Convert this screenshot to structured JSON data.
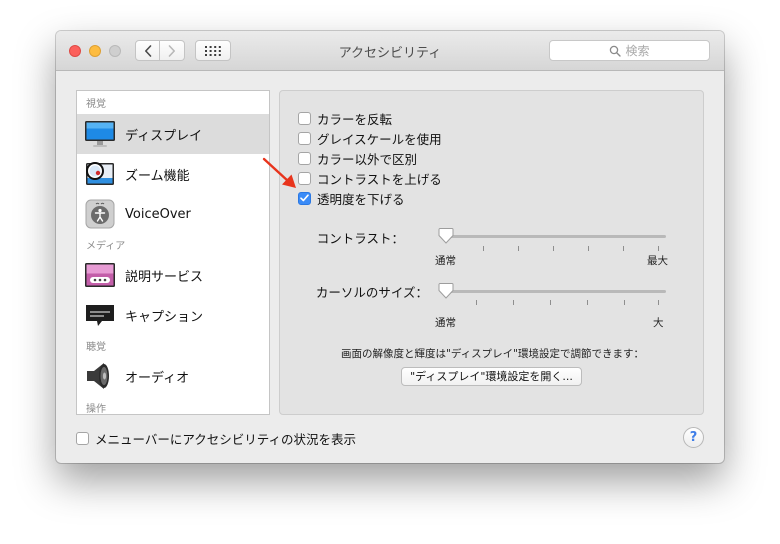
{
  "window": {
    "title": "アクセシビリティ"
  },
  "toolbar": {
    "search_placeholder": "検索"
  },
  "sidebar": {
    "sections": {
      "vision": "視覚",
      "media": "メディア",
      "hearing": "聴覚",
      "interaction": "操作"
    },
    "items": [
      {
        "label": "ディスプレイ",
        "icon": "display-icon",
        "selected": true
      },
      {
        "label": "ズーム機能",
        "icon": "zoom-icon",
        "selected": false
      },
      {
        "label": "VoiceOver",
        "icon": "voiceover-icon",
        "selected": false
      },
      {
        "label": "説明サービス",
        "icon": "descriptions-icon",
        "selected": false
      },
      {
        "label": "キャプション",
        "icon": "captions-icon",
        "selected": false
      },
      {
        "label": "オーディオ",
        "icon": "speaker-icon",
        "selected": false
      }
    ]
  },
  "display": {
    "options": [
      {
        "label": "カラーを反転",
        "checked": false
      },
      {
        "label": "グレイスケールを使用",
        "checked": false
      },
      {
        "label": "カラー以外で区別",
        "checked": false
      },
      {
        "label": "コントラストを上げる",
        "checked": false
      },
      {
        "label": "透明度を下げる",
        "checked": true
      }
    ],
    "contrast": {
      "label": "コントラスト：",
      "min_label": "通常",
      "max_label": "最大",
      "value": 0
    },
    "cursor": {
      "label": "カーソルのサイズ：",
      "min_label": "通常",
      "max_label": "大",
      "value": 0
    },
    "note": "画面の解像度と輝度は\"ディスプレイ\"環境設定で調節できます：",
    "open_button": "\"ディスプレイ\"環境設定を開く..."
  },
  "footer": {
    "menubar_label": "メニューバーにアクセシビリティの状況を表示",
    "menubar_checked": false,
    "help": "?"
  },
  "colors": {
    "accent": "#3a8bf7",
    "annotation_arrow": "#e8341c"
  }
}
